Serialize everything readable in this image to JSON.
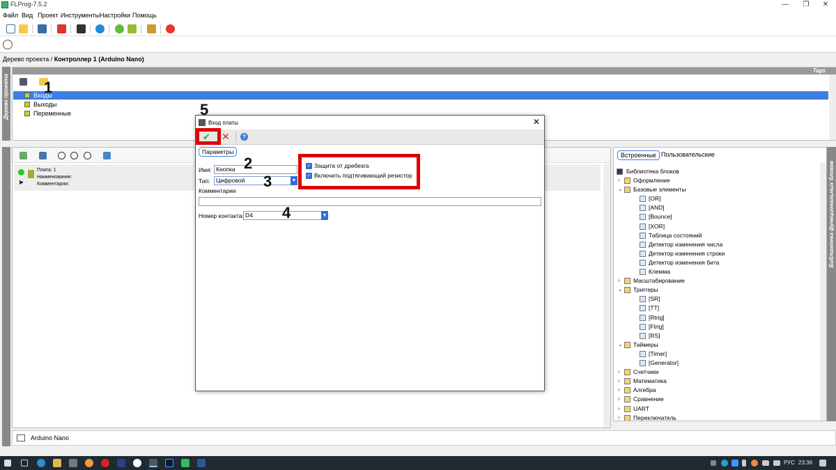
{
  "window": {
    "title": "FLProg-7.5.2",
    "minimize": "—",
    "maximize": "❐",
    "close": "✕"
  },
  "menu": [
    "Файл",
    "Вид",
    "Проект",
    "Инструменты",
    "Настройки",
    "Помощь"
  ],
  "breadcrumb": {
    "root": "Дерево проекта /",
    "current": "Контроллер 1 (Arduino Nano)"
  },
  "left_strip_label": "Дерево проекта",
  "tree": {
    "header_tag": "Tags",
    "items": [
      "Входы",
      "Выходы",
      "Переменные"
    ],
    "selected": 0
  },
  "board": {
    "line1": "Плата: 1",
    "line2": "Наименование:",
    "line3": "Комментарии:"
  },
  "library": {
    "tabs": [
      "Встроенные",
      "Пользовательские"
    ],
    "side_label": "Библиотека функциональных блоков",
    "root": "Библиотека блоков",
    "items": [
      {
        "label": "Оформление",
        "level": 0,
        "exp": ">"
      },
      {
        "label": "Базовые элементы",
        "level": 0,
        "exp": "v"
      },
      {
        "label": "[OR]",
        "level": 1,
        "exp": ""
      },
      {
        "label": "[AND]",
        "level": 1,
        "exp": ""
      },
      {
        "label": "[Bounce]",
        "level": 1,
        "exp": ""
      },
      {
        "label": "[XOR]",
        "level": 1,
        "exp": ""
      },
      {
        "label": "Таблица состояний",
        "level": 1,
        "exp": ""
      },
      {
        "label": "Детектор изменения числа",
        "level": 1,
        "exp": ""
      },
      {
        "label": "Детектор изменения строки",
        "level": 1,
        "exp": ""
      },
      {
        "label": "Детектор изменения бита",
        "level": 1,
        "exp": ""
      },
      {
        "label": "Клемма",
        "level": 1,
        "exp": ""
      },
      {
        "label": "Масштабирование",
        "level": 0,
        "exp": ">"
      },
      {
        "label": "Триггеры",
        "level": 0,
        "exp": "v"
      },
      {
        "label": "[SR]",
        "level": 1,
        "exp": ""
      },
      {
        "label": "[TT]",
        "level": 1,
        "exp": ""
      },
      {
        "label": "[Rtrig]",
        "level": 1,
        "exp": ""
      },
      {
        "label": "[Ftrig]",
        "level": 1,
        "exp": ""
      },
      {
        "label": "[RS]",
        "level": 1,
        "exp": ""
      },
      {
        "label": "Таймеры",
        "level": 0,
        "exp": "v"
      },
      {
        "label": "[Timer]",
        "level": 1,
        "exp": ""
      },
      {
        "label": "[Generator]",
        "level": 1,
        "exp": ""
      },
      {
        "label": "Счетчики",
        "level": 0,
        "exp": ">"
      },
      {
        "label": "Математика",
        "level": 0,
        "exp": ">"
      },
      {
        "label": "Алгебра",
        "level": 0,
        "exp": ">"
      },
      {
        "label": "Сравнение",
        "level": 0,
        "exp": ">"
      },
      {
        "label": "UART",
        "level": 0,
        "exp": ">"
      },
      {
        "label": "Переключатель",
        "level": 0,
        "exp": ">"
      }
    ]
  },
  "bottom_tab": "Arduino Nano",
  "dialog": {
    "title": "Вход платы",
    "close": "✕",
    "ok": "✔",
    "cancel": "✕",
    "help": "?",
    "tab": "Параметры",
    "name_label": "Имя:",
    "name_value": "Кнопка",
    "type_label": "Тип:",
    "type_value": "Цифровой",
    "comments_label": "Комментарии",
    "comments_value": "",
    "pin_label": "Номер контакта:",
    "pin_value": "D4",
    "debounce_label": "Защита от дребезга",
    "debounce_checked": true,
    "pullup_label": "Включить подтягивающий резистор",
    "pullup_checked": true
  },
  "annotations": [
    "1",
    "2",
    "3",
    "4",
    "5"
  ],
  "taskbar": {
    "lang": "РУС",
    "time": "23:36"
  },
  "colors": {
    "accent": "#3c7fe0",
    "annotation": "#e00000",
    "taskbar": "#1f2a33"
  }
}
